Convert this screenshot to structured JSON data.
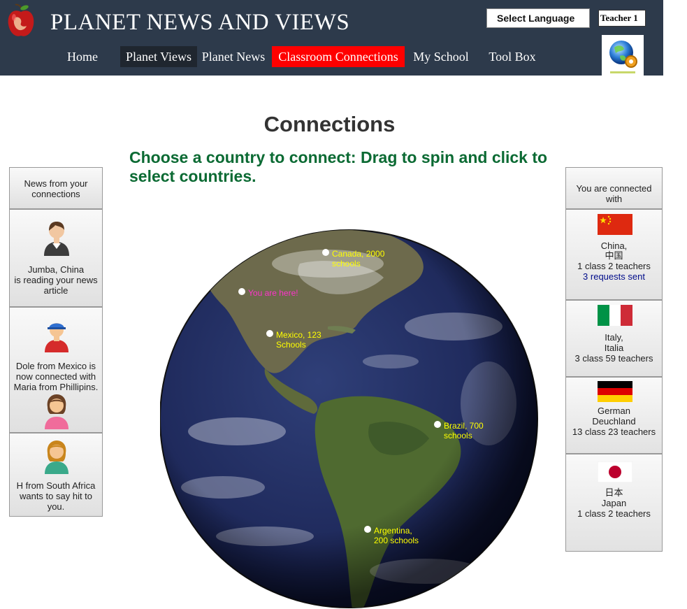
{
  "header": {
    "site_title": "PLANET NEWS AND VIEWS",
    "language_label": "Select Language",
    "user_label": "Teacher 1",
    "logo_icon": "apple-globe-icon",
    "tools_icon": "globe-gear-icon"
  },
  "nav": {
    "items": [
      {
        "label": "Home"
      },
      {
        "label": "Planet Views"
      },
      {
        "label": "Planet News"
      },
      {
        "label": "Classroom Connections"
      },
      {
        "label": "My School"
      },
      {
        "label": "Tool Box"
      }
    ],
    "active_color": "#ff0000"
  },
  "main": {
    "title": "Connections",
    "instructions": "Choose a country to connect: Drag to spin and click to select countries."
  },
  "news": {
    "header": "News from your connections",
    "items": [
      {
        "text": "Jumba, China\nis reading your news article",
        "avatar": "boy-avatar-icon"
      },
      {
        "text": "Dole from Mexico is now connected with Maria from Phillipins.",
        "avatar": "boy-cap-avatar-icon",
        "avatar2": "girl-avatar-icon"
      },
      {
        "text": "H from South Africa wants to say hit to you.",
        "avatar": "girl-avatar-icon"
      }
    ]
  },
  "connections": {
    "header": "You are connected with",
    "items": [
      {
        "flag": "china-flag",
        "line1": "China,",
        "line2": "中国",
        "line3": "1 class 2 teachers",
        "line4": "3 requests sent"
      },
      {
        "flag": "italy-flag",
        "line1": "Italy,",
        "line2": "Italia",
        "line3": "3 class 59 teachers"
      },
      {
        "flag": "germany-flag",
        "line1": "German",
        "line2": "Deuchland",
        "line3": "13 class 23 teachers"
      },
      {
        "flag": "japan-flag",
        "line1": "日本",
        "line2": "Japan",
        "line3": "1 class 2 teachers"
      }
    ]
  },
  "globe": {
    "markers": [
      {
        "label": "Canada, 2000\nschools"
      },
      {
        "label": "You are here!"
      },
      {
        "label": "Mexico, 123\nSchools"
      },
      {
        "label": "Brazil, 700\nschools"
      },
      {
        "label": "Argentina,\n200 schools"
      }
    ],
    "label_color": "#ffff00",
    "home_label_color": "#ff33cc"
  }
}
